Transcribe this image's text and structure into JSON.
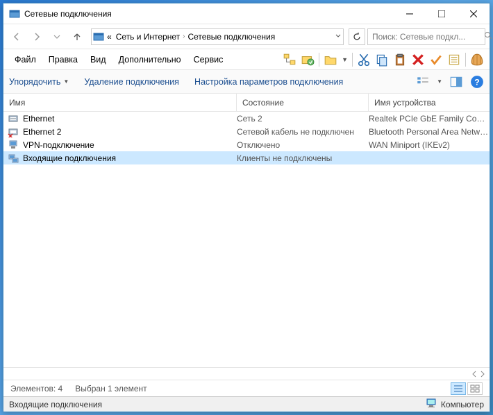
{
  "title": "Сетевые подключения",
  "breadcrumb": {
    "prefix": "«",
    "seg1": "Сеть и Интернет",
    "seg2": "Сетевые подключения"
  },
  "search_placeholder": "Поиск: Сетевые подкл...",
  "menu": {
    "file": "Файл",
    "edit": "Правка",
    "view": "Вид",
    "extra": "Дополнительно",
    "service": "Сервис"
  },
  "cmd": {
    "organize": "Упорядочить",
    "delete": "Удаление подключения",
    "settings": "Настройка параметров подключения"
  },
  "columns": {
    "name": "Имя",
    "status": "Состояние",
    "device": "Имя устройства"
  },
  "rows": [
    {
      "name": "Ethernet",
      "status": "Сеть 2",
      "device": "Realtek PCIe GbE Family Contro...",
      "icon": "eth",
      "selected": false
    },
    {
      "name": "Ethernet 2",
      "status": "Сетевой кабель не подключен",
      "device": "Bluetooth Personal Area Network",
      "icon": "eth-x",
      "selected": false
    },
    {
      "name": "VPN-подключение",
      "status": "Отключено",
      "device": "WAN Miniport (IKEv2)",
      "icon": "vpn",
      "selected": false
    },
    {
      "name": "Входящие подключения",
      "status": "Клиенты не подключены",
      "device": "",
      "icon": "incoming",
      "selected": true
    }
  ],
  "status": {
    "elements": "Элементов: 4",
    "selected": "Выбран 1 элемент"
  },
  "taskbar": {
    "left": "Входящие подключения",
    "right": "Компьютер"
  }
}
